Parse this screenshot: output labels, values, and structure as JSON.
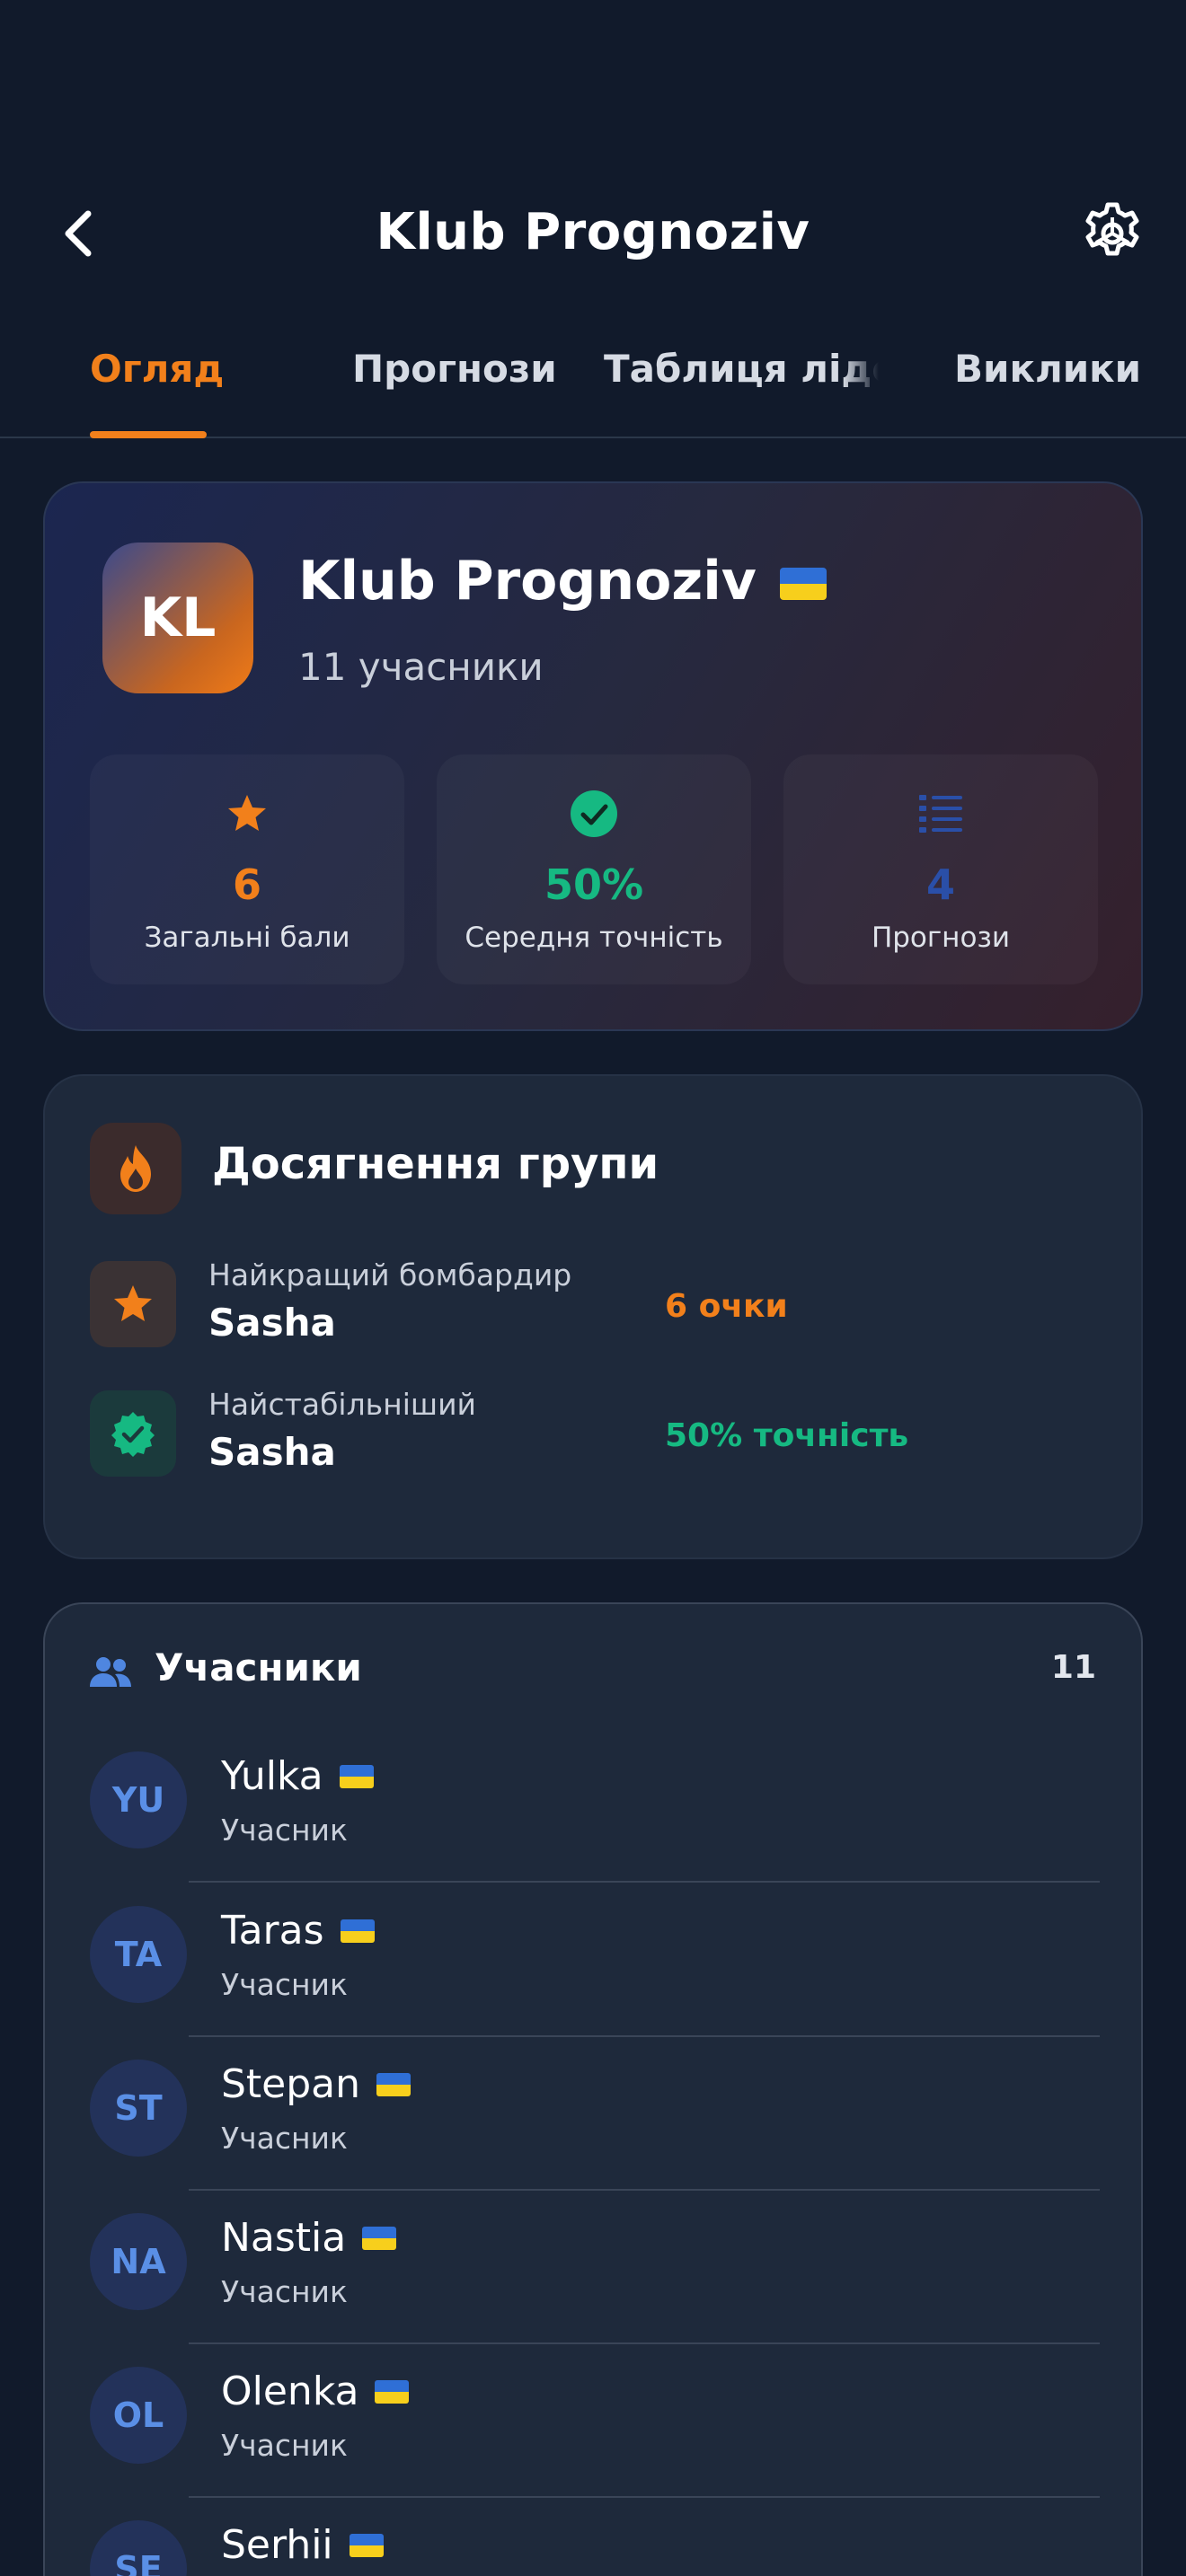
{
  "header": {
    "title": "Klub Prognoziv",
    "back_icon": "chevron-left-icon",
    "settings_icon": "gear-icon"
  },
  "tabs": [
    {
      "label": "Огляд",
      "active": true
    },
    {
      "label": "Прогнози",
      "active": false
    },
    {
      "label": "Таблиця лідерів",
      "active": false
    },
    {
      "label": "Виклики",
      "active": false
    }
  ],
  "group": {
    "initials": "KL",
    "name": "Klub Prognoziv",
    "flag": "ukraine-flag-icon",
    "members_text": "11 учасники",
    "stats": [
      {
        "icon": "star-icon",
        "value": "6",
        "label": "Загальні бали",
        "color": "#f2801b"
      },
      {
        "icon": "check-circle-icon",
        "value": "50%",
        "label": "Середня точність",
        "color": "#16b982"
      },
      {
        "icon": "list-icon",
        "value": "4",
        "label": "Прогнози",
        "color": "#2a4fa8"
      }
    ]
  },
  "achievements": {
    "title": "Досягнення групи",
    "icon": "fire-icon",
    "items": [
      {
        "icon": "star-icon",
        "caption": "Найкращий бомбардир",
        "name": "Sasha",
        "value": "6 очки",
        "color": "#f2801b"
      },
      {
        "icon": "verified-badge-icon",
        "caption": "Найстабільніший",
        "name": "Sasha",
        "value": "50% точність",
        "color": "#16b982"
      }
    ]
  },
  "members": {
    "title": "Учасники",
    "icon": "users-icon",
    "count": "11",
    "list": [
      {
        "initials": "YU",
        "name": "Yulka",
        "role": "Учасник"
      },
      {
        "initials": "TA",
        "name": "Taras",
        "role": "Учасник"
      },
      {
        "initials": "ST",
        "name": "Stepan",
        "role": "Учасник"
      },
      {
        "initials": "NA",
        "name": "Nastia",
        "role": "Учасник"
      },
      {
        "initials": "OL",
        "name": "Olenka",
        "role": "Учасник"
      },
      {
        "initials": "SE",
        "name": "Serhii",
        "role": ""
      }
    ]
  }
}
